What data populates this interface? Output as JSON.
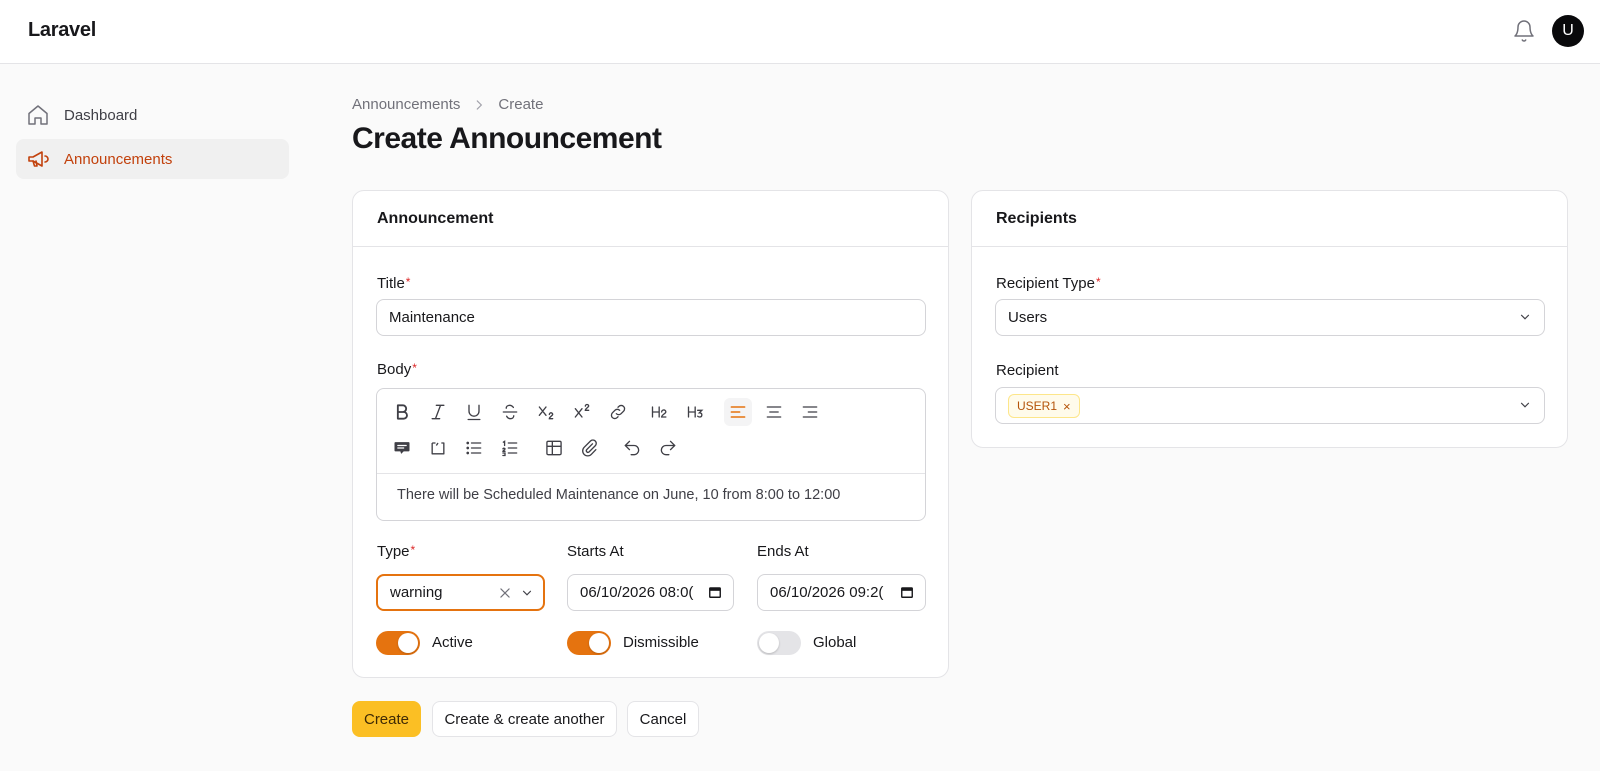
{
  "app": {
    "brand": "Laravel",
    "avatar_initial": "U"
  },
  "sidebar": {
    "items": [
      {
        "label": "Dashboard",
        "icon": "home-icon"
      },
      {
        "label": "Announcements",
        "icon": "megaphone-icon"
      }
    ]
  },
  "breadcrumb": {
    "parent": "Announcements",
    "current": "Create"
  },
  "page": {
    "title": "Create Announcement"
  },
  "announcement_card": {
    "heading": "Announcement",
    "title_label": "Title",
    "title_value": "Maintenance",
    "body_label": "Body",
    "body_value": "There will be Scheduled Maintenance on June, 10 from 8:00 to 12:00",
    "type_label": "Type",
    "type_value": "warning",
    "starts_label": "Starts At",
    "starts_value": "06/10/2026 08:0(",
    "ends_label": "Ends At",
    "ends_value": "06/10/2026 09:2(",
    "active_label": "Active",
    "dismissible_label": "Dismissible",
    "global_label": "Global",
    "active_on": true,
    "dismissible_on": true,
    "global_on": false
  },
  "recipients_card": {
    "heading": "Recipients",
    "type_label": "Recipient Type",
    "type_value": "Users",
    "recipient_label": "Recipient",
    "tag": "USER1",
    "tag_remove": "×"
  },
  "actions": {
    "create": "Create",
    "create_another": "Create & create another",
    "cancel": "Cancel"
  },
  "colors": {
    "accent": "#e5730f",
    "primary_button": "#fbbf24",
    "active_nav": "#c2410c"
  }
}
